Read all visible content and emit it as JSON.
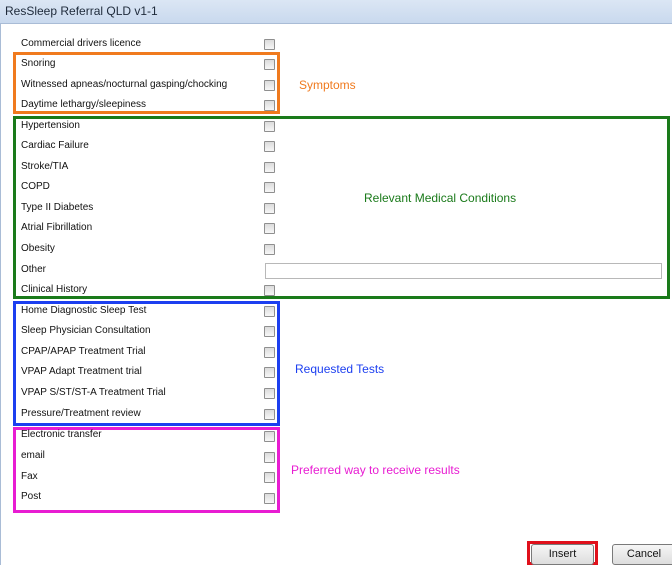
{
  "window": {
    "title": "ResSleep Referral QLD v1-1"
  },
  "annotations": {
    "symptoms": "Symptoms",
    "conditions": "Relevant Medical Conditions",
    "tests": "Requested Tests",
    "results": "Preferred way to receive results"
  },
  "colors": {
    "symptoms": "#f07a1e",
    "conditions": "#1a7a1a",
    "tests": "#1c3ff0",
    "results": "#e81cd2",
    "insert_highlight": "#e0101b"
  },
  "fields": {
    "commercial_drivers": "Commercial drivers licence",
    "snoring": "Snoring",
    "witnessed_apneas": "Witnessed apneas/nocturnal gasping/chocking",
    "daytime_lethargy": "Daytime lethargy/sleepiness",
    "hypertension": "Hypertension",
    "cardiac_failure": "Cardiac Failure",
    "stroke_tia": "Stroke/TIA",
    "copd": "COPD",
    "type2_diabetes": "Type II Diabetes",
    "atrial_fibrillation": "Atrial Fibrillation",
    "obesity": "Obesity",
    "other": "Other",
    "clinical_history": "Clinical History",
    "home_diagnostic": "Home Diagnostic Sleep Test",
    "sleep_physician": "Sleep Physician Consultation",
    "cpap_trial": "CPAP/APAP Treatment Trial",
    "vpap_adapt": "VPAP Adapt Treatment trial",
    "vpap_s_st": "VPAP S/ST/ST-A Treatment Trial",
    "pressure_review": "Pressure/Treatment review",
    "electronic_transfer": "Electronic transfer",
    "email": "email",
    "fax": "Fax",
    "post": "Post"
  },
  "other_input": {
    "value": ""
  },
  "buttons": {
    "insert": "Insert",
    "cancel": "Cancel"
  }
}
